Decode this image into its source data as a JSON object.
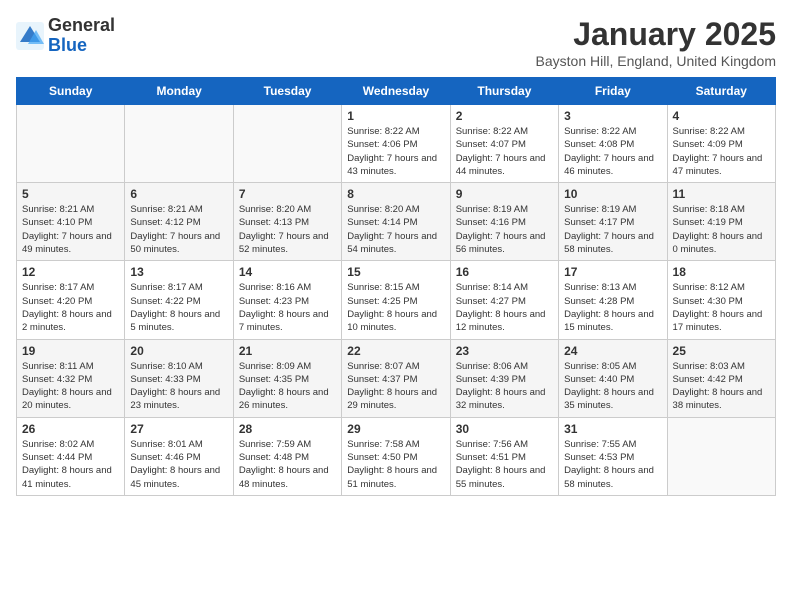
{
  "header": {
    "logo_general": "General",
    "logo_blue": "Blue",
    "month_title": "January 2025",
    "location": "Bayston Hill, England, United Kingdom"
  },
  "weekdays": [
    "Sunday",
    "Monday",
    "Tuesday",
    "Wednesday",
    "Thursday",
    "Friday",
    "Saturday"
  ],
  "weeks": [
    [
      {
        "day": "",
        "sunrise": "",
        "sunset": "",
        "daylight": ""
      },
      {
        "day": "",
        "sunrise": "",
        "sunset": "",
        "daylight": ""
      },
      {
        "day": "",
        "sunrise": "",
        "sunset": "",
        "daylight": ""
      },
      {
        "day": "1",
        "sunrise": "Sunrise: 8:22 AM",
        "sunset": "Sunset: 4:06 PM",
        "daylight": "Daylight: 7 hours and 43 minutes."
      },
      {
        "day": "2",
        "sunrise": "Sunrise: 8:22 AM",
        "sunset": "Sunset: 4:07 PM",
        "daylight": "Daylight: 7 hours and 44 minutes."
      },
      {
        "day": "3",
        "sunrise": "Sunrise: 8:22 AM",
        "sunset": "Sunset: 4:08 PM",
        "daylight": "Daylight: 7 hours and 46 minutes."
      },
      {
        "day": "4",
        "sunrise": "Sunrise: 8:22 AM",
        "sunset": "Sunset: 4:09 PM",
        "daylight": "Daylight: 7 hours and 47 minutes."
      }
    ],
    [
      {
        "day": "5",
        "sunrise": "Sunrise: 8:21 AM",
        "sunset": "Sunset: 4:10 PM",
        "daylight": "Daylight: 7 hours and 49 minutes."
      },
      {
        "day": "6",
        "sunrise": "Sunrise: 8:21 AM",
        "sunset": "Sunset: 4:12 PM",
        "daylight": "Daylight: 7 hours and 50 minutes."
      },
      {
        "day": "7",
        "sunrise": "Sunrise: 8:20 AM",
        "sunset": "Sunset: 4:13 PM",
        "daylight": "Daylight: 7 hours and 52 minutes."
      },
      {
        "day": "8",
        "sunrise": "Sunrise: 8:20 AM",
        "sunset": "Sunset: 4:14 PM",
        "daylight": "Daylight: 7 hours and 54 minutes."
      },
      {
        "day": "9",
        "sunrise": "Sunrise: 8:19 AM",
        "sunset": "Sunset: 4:16 PM",
        "daylight": "Daylight: 7 hours and 56 minutes."
      },
      {
        "day": "10",
        "sunrise": "Sunrise: 8:19 AM",
        "sunset": "Sunset: 4:17 PM",
        "daylight": "Daylight: 7 hours and 58 minutes."
      },
      {
        "day": "11",
        "sunrise": "Sunrise: 8:18 AM",
        "sunset": "Sunset: 4:19 PM",
        "daylight": "Daylight: 8 hours and 0 minutes."
      }
    ],
    [
      {
        "day": "12",
        "sunrise": "Sunrise: 8:17 AM",
        "sunset": "Sunset: 4:20 PM",
        "daylight": "Daylight: 8 hours and 2 minutes."
      },
      {
        "day": "13",
        "sunrise": "Sunrise: 8:17 AM",
        "sunset": "Sunset: 4:22 PM",
        "daylight": "Daylight: 8 hours and 5 minutes."
      },
      {
        "day": "14",
        "sunrise": "Sunrise: 8:16 AM",
        "sunset": "Sunset: 4:23 PM",
        "daylight": "Daylight: 8 hours and 7 minutes."
      },
      {
        "day": "15",
        "sunrise": "Sunrise: 8:15 AM",
        "sunset": "Sunset: 4:25 PM",
        "daylight": "Daylight: 8 hours and 10 minutes."
      },
      {
        "day": "16",
        "sunrise": "Sunrise: 8:14 AM",
        "sunset": "Sunset: 4:27 PM",
        "daylight": "Daylight: 8 hours and 12 minutes."
      },
      {
        "day": "17",
        "sunrise": "Sunrise: 8:13 AM",
        "sunset": "Sunset: 4:28 PM",
        "daylight": "Daylight: 8 hours and 15 minutes."
      },
      {
        "day": "18",
        "sunrise": "Sunrise: 8:12 AM",
        "sunset": "Sunset: 4:30 PM",
        "daylight": "Daylight: 8 hours and 17 minutes."
      }
    ],
    [
      {
        "day": "19",
        "sunrise": "Sunrise: 8:11 AM",
        "sunset": "Sunset: 4:32 PM",
        "daylight": "Daylight: 8 hours and 20 minutes."
      },
      {
        "day": "20",
        "sunrise": "Sunrise: 8:10 AM",
        "sunset": "Sunset: 4:33 PM",
        "daylight": "Daylight: 8 hours and 23 minutes."
      },
      {
        "day": "21",
        "sunrise": "Sunrise: 8:09 AM",
        "sunset": "Sunset: 4:35 PM",
        "daylight": "Daylight: 8 hours and 26 minutes."
      },
      {
        "day": "22",
        "sunrise": "Sunrise: 8:07 AM",
        "sunset": "Sunset: 4:37 PM",
        "daylight": "Daylight: 8 hours and 29 minutes."
      },
      {
        "day": "23",
        "sunrise": "Sunrise: 8:06 AM",
        "sunset": "Sunset: 4:39 PM",
        "daylight": "Daylight: 8 hours and 32 minutes."
      },
      {
        "day": "24",
        "sunrise": "Sunrise: 8:05 AM",
        "sunset": "Sunset: 4:40 PM",
        "daylight": "Daylight: 8 hours and 35 minutes."
      },
      {
        "day": "25",
        "sunrise": "Sunrise: 8:03 AM",
        "sunset": "Sunset: 4:42 PM",
        "daylight": "Daylight: 8 hours and 38 minutes."
      }
    ],
    [
      {
        "day": "26",
        "sunrise": "Sunrise: 8:02 AM",
        "sunset": "Sunset: 4:44 PM",
        "daylight": "Daylight: 8 hours and 41 minutes."
      },
      {
        "day": "27",
        "sunrise": "Sunrise: 8:01 AM",
        "sunset": "Sunset: 4:46 PM",
        "daylight": "Daylight: 8 hours and 45 minutes."
      },
      {
        "day": "28",
        "sunrise": "Sunrise: 7:59 AM",
        "sunset": "Sunset: 4:48 PM",
        "daylight": "Daylight: 8 hours and 48 minutes."
      },
      {
        "day": "29",
        "sunrise": "Sunrise: 7:58 AM",
        "sunset": "Sunset: 4:50 PM",
        "daylight": "Daylight: 8 hours and 51 minutes."
      },
      {
        "day": "30",
        "sunrise": "Sunrise: 7:56 AM",
        "sunset": "Sunset: 4:51 PM",
        "daylight": "Daylight: 8 hours and 55 minutes."
      },
      {
        "day": "31",
        "sunrise": "Sunrise: 7:55 AM",
        "sunset": "Sunset: 4:53 PM",
        "daylight": "Daylight: 8 hours and 58 minutes."
      },
      {
        "day": "",
        "sunrise": "",
        "sunset": "",
        "daylight": ""
      }
    ]
  ]
}
